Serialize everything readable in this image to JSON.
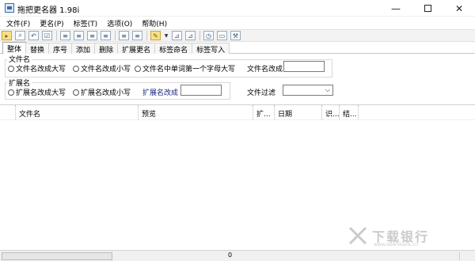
{
  "window": {
    "title": "拖把更名器 1.98i"
  },
  "menu": [
    "文件(F)",
    "更名(P)",
    "标签(T)",
    "选项(O)",
    "帮助(H)"
  ],
  "toolbar": {
    "icons": [
      "open-folder-icon",
      "search-icon",
      "undo-icon",
      "checkbox-icon",
      "list-icon",
      "list-icon",
      "list-icon",
      "list-icon",
      "list-icon",
      "list-icon",
      "pen-icon",
      "tag-icon",
      "tag-edit-icon",
      "clock-icon",
      "window-icon",
      "wrench-icon"
    ]
  },
  "tabs": [
    "整体",
    "替换",
    "序号",
    "添加",
    "删除",
    "扩展更名",
    "标签命名",
    "标签写入"
  ],
  "filename_group": {
    "title": "文件名",
    "options": [
      "文件名改成大写",
      "文件名改成小写",
      "文件名中单词第一个字母大写"
    ],
    "rename_label": "文件名改成",
    "rename_value": ""
  },
  "ext_group": {
    "title": "扩展名",
    "options": [
      "扩展名改成大写",
      "扩展名改成小写"
    ],
    "rename_label": "扩展名改成",
    "rename_value": ""
  },
  "filter": {
    "label": "文件过滤",
    "value": ""
  },
  "columns": [
    "文件名",
    "预览",
    "扩...",
    "日期",
    "识...",
    "结..."
  ],
  "status": {
    "count": "0",
    "progress": 0
  },
  "watermark": {
    "text": "下载银行",
    "url": "www.downbank.cn"
  }
}
